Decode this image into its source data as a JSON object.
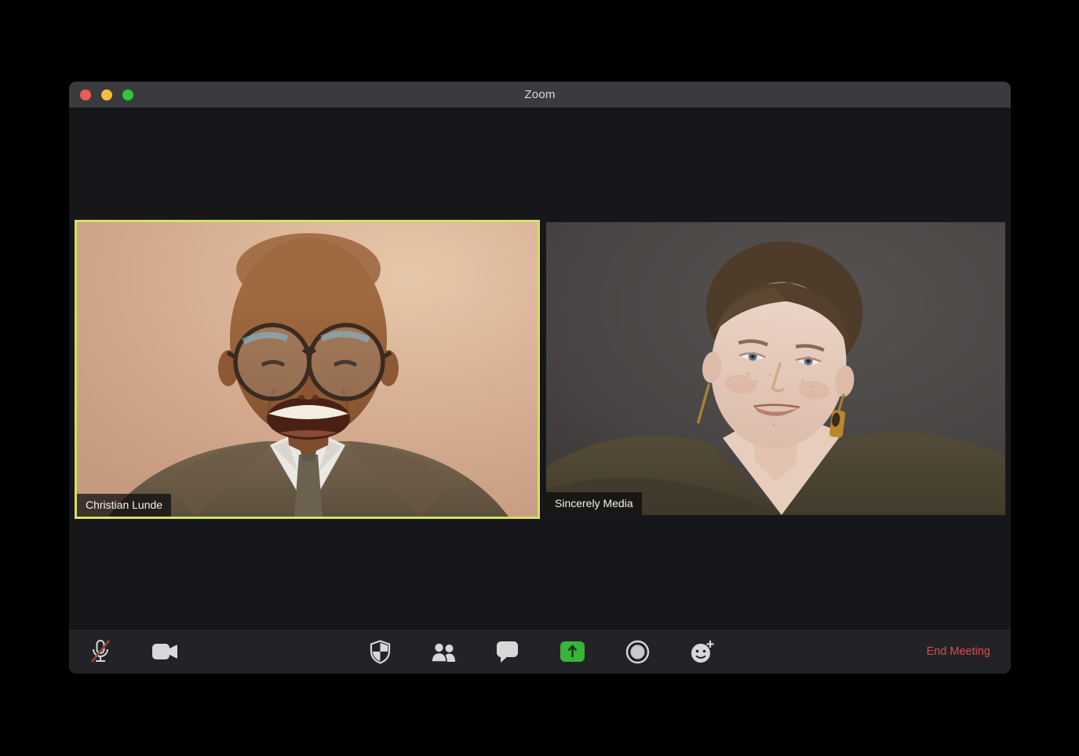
{
  "window": {
    "title": "Zoom"
  },
  "titlebar": {
    "traffic_lights": [
      "close",
      "minimize",
      "fullscreen"
    ]
  },
  "participants": [
    {
      "name": "Christian Lunde",
      "active_speaker": true
    },
    {
      "name": "Sincerely Media",
      "active_speaker": false
    }
  ],
  "toolbar": {
    "icons": [
      "microphone-muted-icon",
      "video-camera-icon",
      "security-shield-icon",
      "participants-icon",
      "chat-icon",
      "share-screen-icon",
      "record-icon",
      "reactions-icon"
    ],
    "end_meeting_label": "End Meeting"
  },
  "colors": {
    "active_speaker_border": "#d6e063",
    "share_screen_green": "#3ab33a",
    "end_meeting_red": "#df4950",
    "titlebar": "#3a3b3f",
    "toolbar": "#232327",
    "window_background": "#17171b"
  }
}
